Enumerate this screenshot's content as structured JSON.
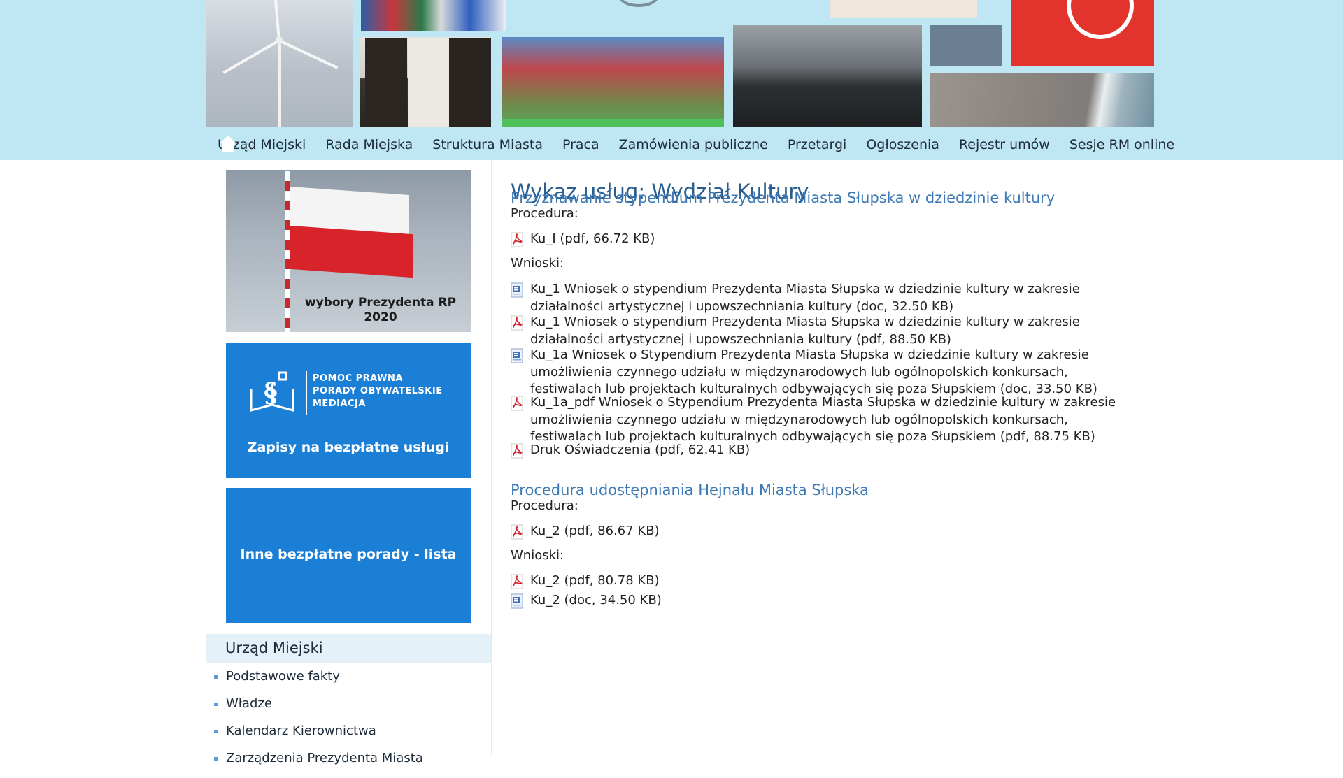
{
  "nav": {
    "items": [
      "Urząd Miejski",
      "Rada Miejska",
      "Struktura Miasta",
      "Praca",
      "Zamówienia publiczne",
      "Przetargi",
      "Ogłoszenia",
      "Rejestr umów",
      "Sesje RM online"
    ]
  },
  "sidebar": {
    "banner_flag_caption": "wybory Prezydenta RP\n2020",
    "banner_legal_small": "POMOC PRAWNA\nPORADY OBYWATELSKIE\nMEDIACJA",
    "banner_legal_big": "Zapisy na bezpłatne usługi",
    "banner_other": "Inne bezpłatne porady - lista",
    "menu_heading": "Urząd Miejski",
    "menu_items": [
      "Podstawowe fakty",
      "Władze",
      "Kalendarz Kierownictwa",
      "Zarządzenia Prezydenta Miasta"
    ]
  },
  "content": {
    "page_title": "Wykaz usług: Wydział Kultury",
    "sections": [
      {
        "title": "Przyznawanie stypendium Prezydenta Miasta Słupska w dziedzinie kultury",
        "procedure_label": "Procedura:",
        "procedure_files": [
          {
            "type": "pdf",
            "text": "Ku_I (pdf, 66.72 KB)"
          }
        ],
        "forms_label": "Wnioski:",
        "form_files": [
          {
            "type": "doc",
            "text": "Ku_1 Wniosek o stypendium Prezydenta Miasta Słupska w dziedzinie kultury w zakresie działalności artystycznej i upowszechniania kultury (doc, 32.50 KB)"
          },
          {
            "type": "pdf",
            "text": "Ku_1 Wniosek o stypendium Prezydenta Miasta Słupska w dziedzinie kultury w zakresie działalności artystycznej i upowszechniania kultury (pdf, 88.50 KB)"
          },
          {
            "type": "doc",
            "text": "Ku_1a Wniosek o Stypendium Prezydenta Miasta Słupska w dziedzinie kultury w zakresie umożliwienia czynnego udziału w międzynarodowych lub ogólnopolskich konkursach, festiwalach lub projektach kulturalnych odbywających się poza Słupskiem (doc, 33.50 KB)"
          },
          {
            "type": "pdf",
            "text": "Ku_1a_pdf Wniosek o Stypendium Prezydenta Miasta Słupska w dziedzinie kultury w zakresie umożliwienia czynnego udziału w międzynarodowych lub ogólnopolskich konkursach, festiwalach lub projektach kulturalnych odbywających się poza Słupskiem (pdf, 88.75 KB)"
          },
          {
            "type": "pdf",
            "text": "Druk Oświadczenia (pdf, 62.41 KB)"
          }
        ]
      },
      {
        "title": "Procedura udostępniania Hejnału Miasta Słupska",
        "procedure_label": "Procedura:",
        "procedure_files": [
          {
            "type": "pdf",
            "text": "Ku_2 (pdf, 86.67 KB)"
          }
        ],
        "forms_label": "Wnioski:",
        "form_files": [
          {
            "type": "pdf",
            "text": "Ku_2 (pdf, 80.78 KB)"
          },
          {
            "type": "doc",
            "text": "Ku_2 (doc, 34.50 KB)"
          }
        ]
      }
    ]
  },
  "colors": {
    "top_band": "#bfe6f3",
    "banner_blue": "#1b7fd6",
    "title_blue": "#2a5d8f",
    "link_blue": "#3d7ab5",
    "pdf_red": "#d8232a"
  }
}
